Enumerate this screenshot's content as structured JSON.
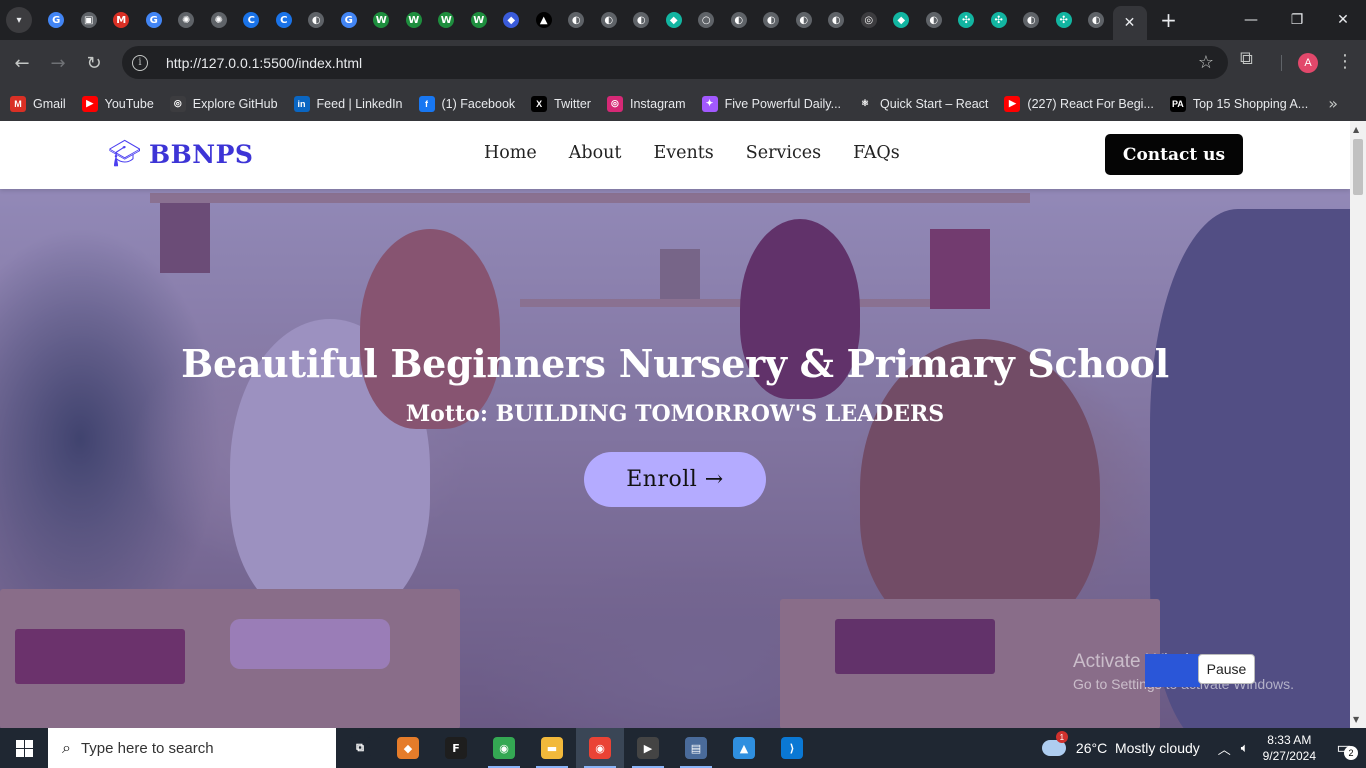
{
  "browser": {
    "tabs": [
      {
        "icon": "google-icon",
        "color": "#4285f4",
        "glyph": "G"
      },
      {
        "icon": "drive-icon",
        "color": "#5f6368",
        "glyph": "▣"
      },
      {
        "icon": "gmail-icon",
        "color": "#d93025",
        "glyph": "M"
      },
      {
        "icon": "google-icon",
        "color": "#4285f4",
        "glyph": "G"
      },
      {
        "icon": "chatgpt-icon",
        "color": "#5f6368",
        "glyph": "✺"
      },
      {
        "icon": "chatgpt-icon",
        "color": "#5f6368",
        "glyph": "✺"
      },
      {
        "icon": "c-icon",
        "color": "#1a73e8",
        "glyph": "C"
      },
      {
        "icon": "c-icon",
        "color": "#1a73e8",
        "glyph": "C"
      },
      {
        "icon": "globe-icon",
        "color": "#5f6368",
        "glyph": "◐"
      },
      {
        "icon": "google-icon",
        "color": "#4285f4",
        "glyph": "G"
      },
      {
        "icon": "w-icon",
        "color": "#1e8e3e",
        "glyph": "W"
      },
      {
        "icon": "w-icon",
        "color": "#1e8e3e",
        "glyph": "W"
      },
      {
        "icon": "w-icon",
        "color": "#1e8e3e",
        "glyph": "W"
      },
      {
        "icon": "w-icon",
        "color": "#1e8e3e",
        "glyph": "W"
      },
      {
        "icon": "shield-icon",
        "color": "#3a5bd9",
        "glyph": "◆"
      },
      {
        "icon": "triangle-icon",
        "color": "#000000",
        "glyph": "▲"
      },
      {
        "icon": "globe-icon",
        "color": "#5f6368",
        "glyph": "◐"
      },
      {
        "icon": "globe-icon",
        "color": "#5f6368",
        "glyph": "◐"
      },
      {
        "icon": "globe-icon",
        "color": "#5f6368",
        "glyph": "◐"
      },
      {
        "icon": "diamond-icon",
        "color": "#12b5a1",
        "glyph": "◆"
      },
      {
        "icon": "loading-icon",
        "color": "#5f6368",
        "glyph": "○"
      },
      {
        "icon": "globe-icon",
        "color": "#5f6368",
        "glyph": "◐"
      },
      {
        "icon": "globe-icon",
        "color": "#5f6368",
        "glyph": "◐"
      },
      {
        "icon": "globe-icon",
        "color": "#5f6368",
        "glyph": "◐"
      },
      {
        "icon": "globe-icon",
        "color": "#5f6368",
        "glyph": "◐"
      },
      {
        "icon": "github-icon",
        "color": "#3c3c3f",
        "glyph": "◎"
      },
      {
        "icon": "diamond-icon",
        "color": "#12b5a1",
        "glyph": "◆"
      },
      {
        "icon": "globe-icon",
        "color": "#5f6368",
        "glyph": "◐"
      },
      {
        "icon": "sparkle-icon",
        "color": "#12b5a1",
        "glyph": "✣"
      },
      {
        "icon": "sparkle-icon",
        "color": "#12b5a1",
        "glyph": "✣"
      },
      {
        "icon": "globe-icon",
        "color": "#5f6368",
        "glyph": "◐"
      },
      {
        "icon": "sparkle-icon",
        "color": "#12b5a1",
        "glyph": "✣"
      },
      {
        "icon": "globe-icon",
        "color": "#5f6368",
        "glyph": "◐"
      }
    ],
    "url": "http://127.0.0.1:5500/index.html",
    "profile_initial": "A",
    "bookmarks": [
      {
        "label": "Gmail",
        "icon": "gmail-icon",
        "color": "#d93025",
        "glyph": "M"
      },
      {
        "label": "YouTube",
        "icon": "youtube-icon",
        "color": "#ff0000",
        "glyph": "▶"
      },
      {
        "label": "Explore GitHub",
        "icon": "github-icon",
        "color": "#3c3c3f",
        "glyph": "◎"
      },
      {
        "label": "Feed | LinkedIn",
        "icon": "linkedin-icon",
        "color": "#0a66c2",
        "glyph": "in"
      },
      {
        "label": "(1) Facebook",
        "icon": "facebook-icon",
        "color": "#1877f2",
        "glyph": "f"
      },
      {
        "label": "Twitter",
        "icon": "x-icon",
        "color": "#000000",
        "glyph": "X"
      },
      {
        "label": "Instagram",
        "icon": "instagram-icon",
        "color": "#d62976",
        "glyph": "◎"
      },
      {
        "label": "Five Powerful Daily...",
        "icon": "figma-icon",
        "color": "#a259ff",
        "glyph": "✦"
      },
      {
        "label": "Quick Start – React",
        "icon": "react-icon",
        "color": "#35363a",
        "glyph": "⚛"
      },
      {
        "label": "(227) React For Begi...",
        "icon": "youtube-icon",
        "color": "#ff0000",
        "glyph": "▶"
      },
      {
        "label": "Top 15 Shopping A...",
        "icon": "pa-icon",
        "color": "#000000",
        "glyph": "PA"
      }
    ]
  },
  "site": {
    "logo_text": "BBNPS",
    "menu": [
      "Home",
      "About",
      "Events",
      "Services",
      "FAQs"
    ],
    "contact_label": "Contact us",
    "hero_title": "Beautiful Beginners Nursery & Primary School",
    "hero_motto": "Motto: BUILDING TOMORROW'S LEADERS",
    "enroll_label": "Enroll →",
    "brand_color": "#3d34d6",
    "overlay_color": "#483caa",
    "enroll_color": "#b4abff"
  },
  "watermark": {
    "line1": "Activate Windows",
    "line2": "Go to Settings to activate Windows."
  },
  "tooltip": {
    "label": "Pause"
  },
  "taskbar": {
    "search_placeholder": "Type here to search",
    "apps": [
      {
        "icon": "task-view-icon",
        "color": "#1f2732",
        "glyph": "⧉"
      },
      {
        "icon": "app-icon",
        "color": "#e57c2a",
        "glyph": "◆"
      },
      {
        "icon": "figma-icon",
        "color": "#1e1e1e",
        "glyph": "F"
      },
      {
        "icon": "chrome-icon",
        "color": "#34a853",
        "glyph": "◉"
      },
      {
        "icon": "file-explorer-icon",
        "color": "#f2b93b",
        "glyph": "▬"
      },
      {
        "icon": "chrome-icon",
        "color": "#ea4335",
        "glyph": "◉"
      },
      {
        "icon": "media-player-icon",
        "color": "#444444",
        "glyph": "▶"
      },
      {
        "icon": "computer-icon",
        "color": "#4a6b9a",
        "glyph": "▤"
      },
      {
        "icon": "photos-icon",
        "color": "#2f8fdf",
        "glyph": "▲"
      },
      {
        "icon": "vscode-icon",
        "color": "#0a78d4",
        "glyph": "⟩"
      }
    ],
    "weather": "26°C  Mostly cloudy",
    "weather_badge": "1",
    "time": "8:33 AM",
    "date": "9/27/2024",
    "notifications": "2"
  }
}
